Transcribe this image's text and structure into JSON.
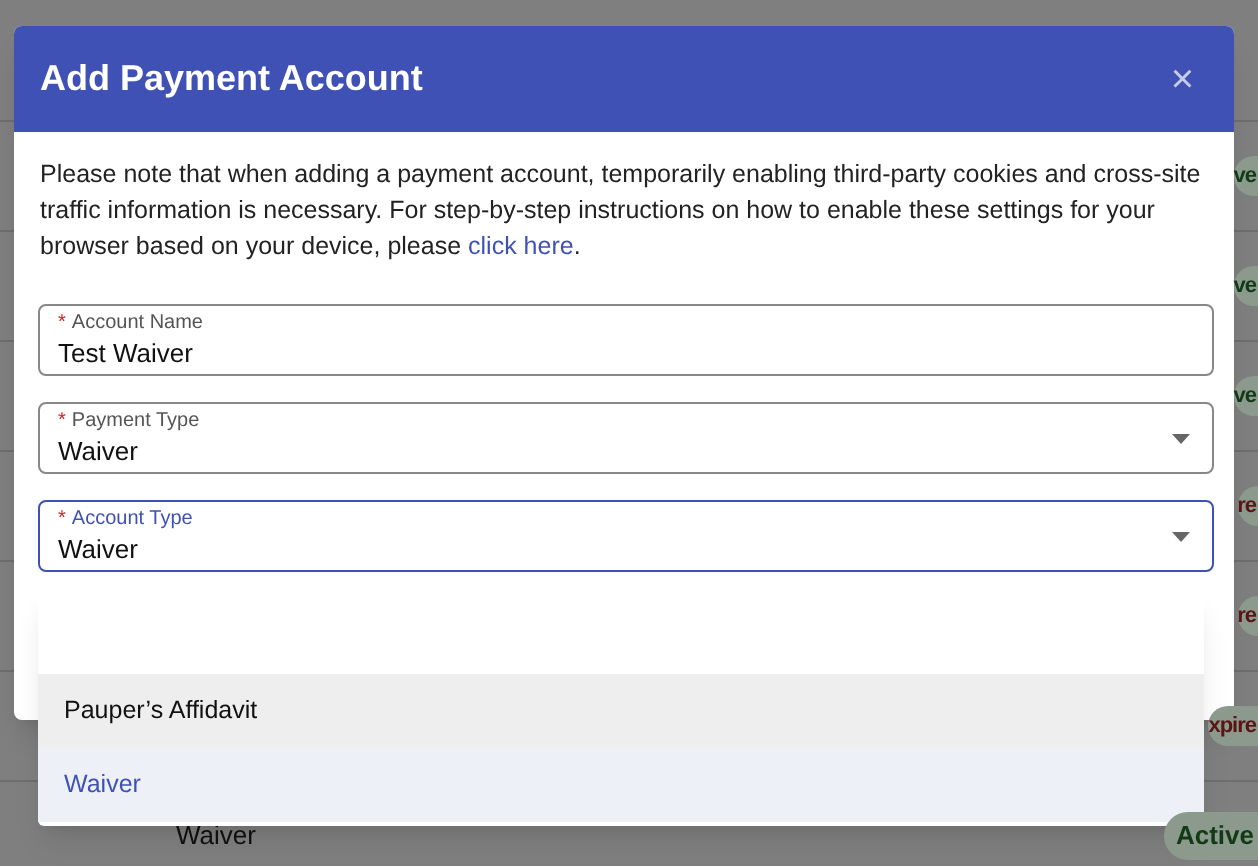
{
  "background": {
    "rows": [
      {
        "status": "ve",
        "color": "#133a17"
      },
      {
        "status": "ve",
        "color": "#133a17"
      },
      {
        "status": "ve",
        "color": "#133a17"
      },
      {
        "status": "re",
        "color": "#5a1414"
      },
      {
        "status": "re",
        "color": "#5a1414"
      },
      {
        "status": "xpire",
        "color": "#5a1414"
      },
      {
        "account_type": "Waiver",
        "status": "Active",
        "color": "#133a17"
      }
    ]
  },
  "dialog": {
    "title": "Add Payment Account",
    "close": "×",
    "notice": {
      "text": "Please note that when adding a payment account, temporarily enabling third-party cookies and cross-site traffic information is necessary. For step-by-step instructions on how to enable these settings for your browser based on your device, please ",
      "link": "click here",
      "end": "."
    },
    "fields": [
      {
        "kind": "text",
        "marker": "*",
        "label": "Account Name",
        "value": "Test Waiver",
        "focused": false
      },
      {
        "kind": "select",
        "marker": "*",
        "label": "Payment Type",
        "value": "Waiver",
        "focused": false
      },
      {
        "kind": "select",
        "marker": "*",
        "label": "Account Type",
        "value": "Waiver",
        "focused": true
      }
    ]
  },
  "dropdown": {
    "options": [
      {
        "kind": "blank",
        "selected": false
      },
      {
        "kind": "option",
        "label": "Pauper’s Affidavit",
        "highlighted": true,
        "selected": false
      },
      {
        "kind": "option",
        "label": "Waiver",
        "selected": true
      }
    ]
  }
}
